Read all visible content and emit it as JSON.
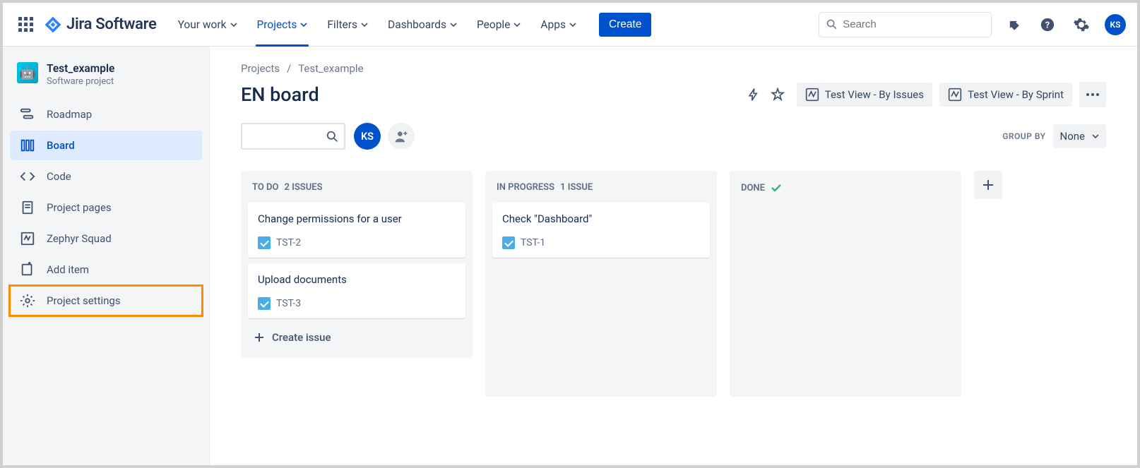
{
  "app": {
    "name": "Jira Software"
  },
  "topnav": {
    "items": [
      {
        "label": "Your work"
      },
      {
        "label": "Projects"
      },
      {
        "label": "Filters"
      },
      {
        "label": "Dashboards"
      },
      {
        "label": "People"
      },
      {
        "label": "Apps"
      }
    ],
    "create": "Create",
    "search_placeholder": "Search",
    "avatar_initials": "KS"
  },
  "sidebar": {
    "project": {
      "name": "Test_example",
      "subtitle": "Software project"
    },
    "items": [
      {
        "label": "Roadmap"
      },
      {
        "label": "Board"
      },
      {
        "label": "Code"
      },
      {
        "label": "Project pages"
      },
      {
        "label": "Zephyr Squad"
      },
      {
        "label": "Add item"
      },
      {
        "label": "Project settings"
      }
    ]
  },
  "breadcrumb": {
    "root": "Projects",
    "project": "Test_example"
  },
  "board": {
    "title": "EN board",
    "views": [
      {
        "label": "Test View - By Issues"
      },
      {
        "label": "Test View - By Sprint"
      }
    ],
    "groupby_label": "GROUP BY",
    "groupby_value": "None",
    "avatar_initials": "KS",
    "create_issue": "Create issue"
  },
  "columns": [
    {
      "name": "TO DO",
      "count_label": "2 ISSUES",
      "done": false,
      "cards": [
        {
          "title": "Change permissions for a user",
          "key": "TST-2"
        },
        {
          "title": "Upload documents",
          "key": "TST-3"
        }
      ]
    },
    {
      "name": "IN PROGRESS",
      "count_label": "1 ISSUE",
      "done": false,
      "cards": [
        {
          "title": "Check \"Dashboard\"",
          "key": "TST-1"
        }
      ]
    },
    {
      "name": "DONE",
      "count_label": "",
      "done": true,
      "cards": []
    }
  ]
}
